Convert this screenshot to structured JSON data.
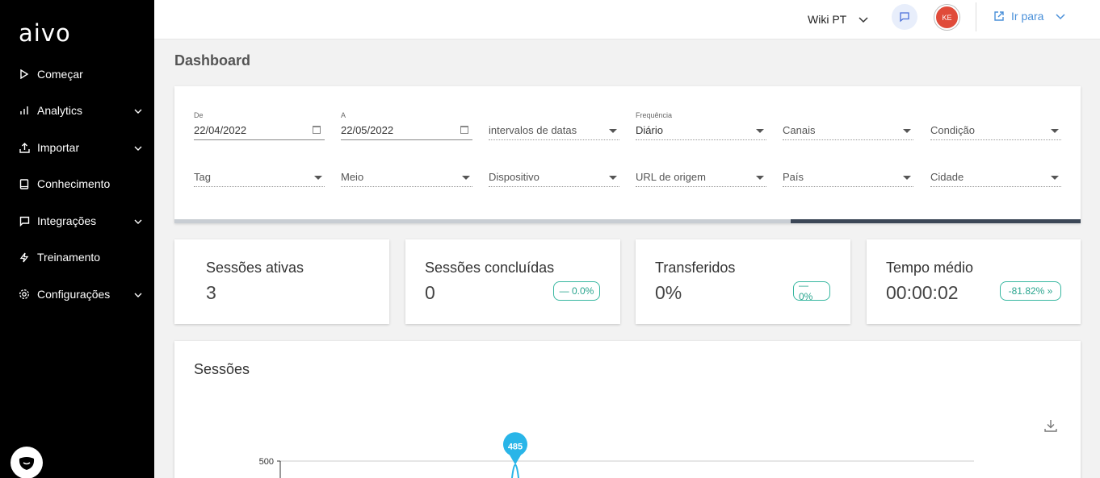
{
  "sidebar": {
    "logo": "aivo",
    "items": [
      {
        "label": "Começar",
        "icon": "play-icon",
        "has_children": false
      },
      {
        "label": "Analytics",
        "icon": "bar-chart-icon",
        "has_children": true
      },
      {
        "label": "Importar",
        "icon": "upload-icon",
        "has_children": true
      },
      {
        "label": "Conhecimento",
        "icon": "book-icon",
        "has_children": false
      },
      {
        "label": "Integrações",
        "icon": "message-icon",
        "has_children": true
      },
      {
        "label": "Treinamento",
        "icon": "bolt-icon",
        "has_children": false
      },
      {
        "label": "Configurações",
        "icon": "gear-icon",
        "has_children": true
      }
    ],
    "bot_icon": "bot-face-icon"
  },
  "topbar": {
    "workspace": "Wiki PT",
    "avatar_initials": "KE",
    "goto_label": "Ir para",
    "accent_color": "#4a90d9",
    "avatar_color": "#e04b3a"
  },
  "page": {
    "title": "Dashboard"
  },
  "filters": {
    "from": {
      "label": "De",
      "value": "22/04/2022"
    },
    "to": {
      "label": "A",
      "value": "22/05/2022"
    },
    "date_ranges": {
      "placeholder": "intervalos de datas"
    },
    "frequency": {
      "label": "Frequência",
      "value": "Diário"
    },
    "channels": {
      "placeholder": "Canais"
    },
    "condition": {
      "placeholder": "Condição"
    },
    "tag": {
      "placeholder": "Tag"
    },
    "medium": {
      "placeholder": "Meio"
    },
    "device": {
      "placeholder": "Dispositivo"
    },
    "origin_url": {
      "placeholder": "URL de origem"
    },
    "country": {
      "placeholder": "País"
    },
    "city": {
      "placeholder": "Cidade"
    },
    "progress": 0.68
  },
  "stats": [
    {
      "title": "Sessões ativas",
      "value": "3",
      "badge": ""
    },
    {
      "title": "Sessões concluídas",
      "value": "0",
      "badge": "— 0.0%"
    },
    {
      "title": "Transferidos",
      "value": "0%",
      "badge": "— 0%"
    },
    {
      "title": "Tempo médio",
      "value": "00:00:02",
      "badge": "-81.82% »"
    }
  ],
  "chart_data": {
    "type": "line",
    "title": "Sessões",
    "y_ticks": [
      "500"
    ],
    "peak_label": "485",
    "peak_value": 485,
    "ylim": [
      0,
      500
    ]
  }
}
